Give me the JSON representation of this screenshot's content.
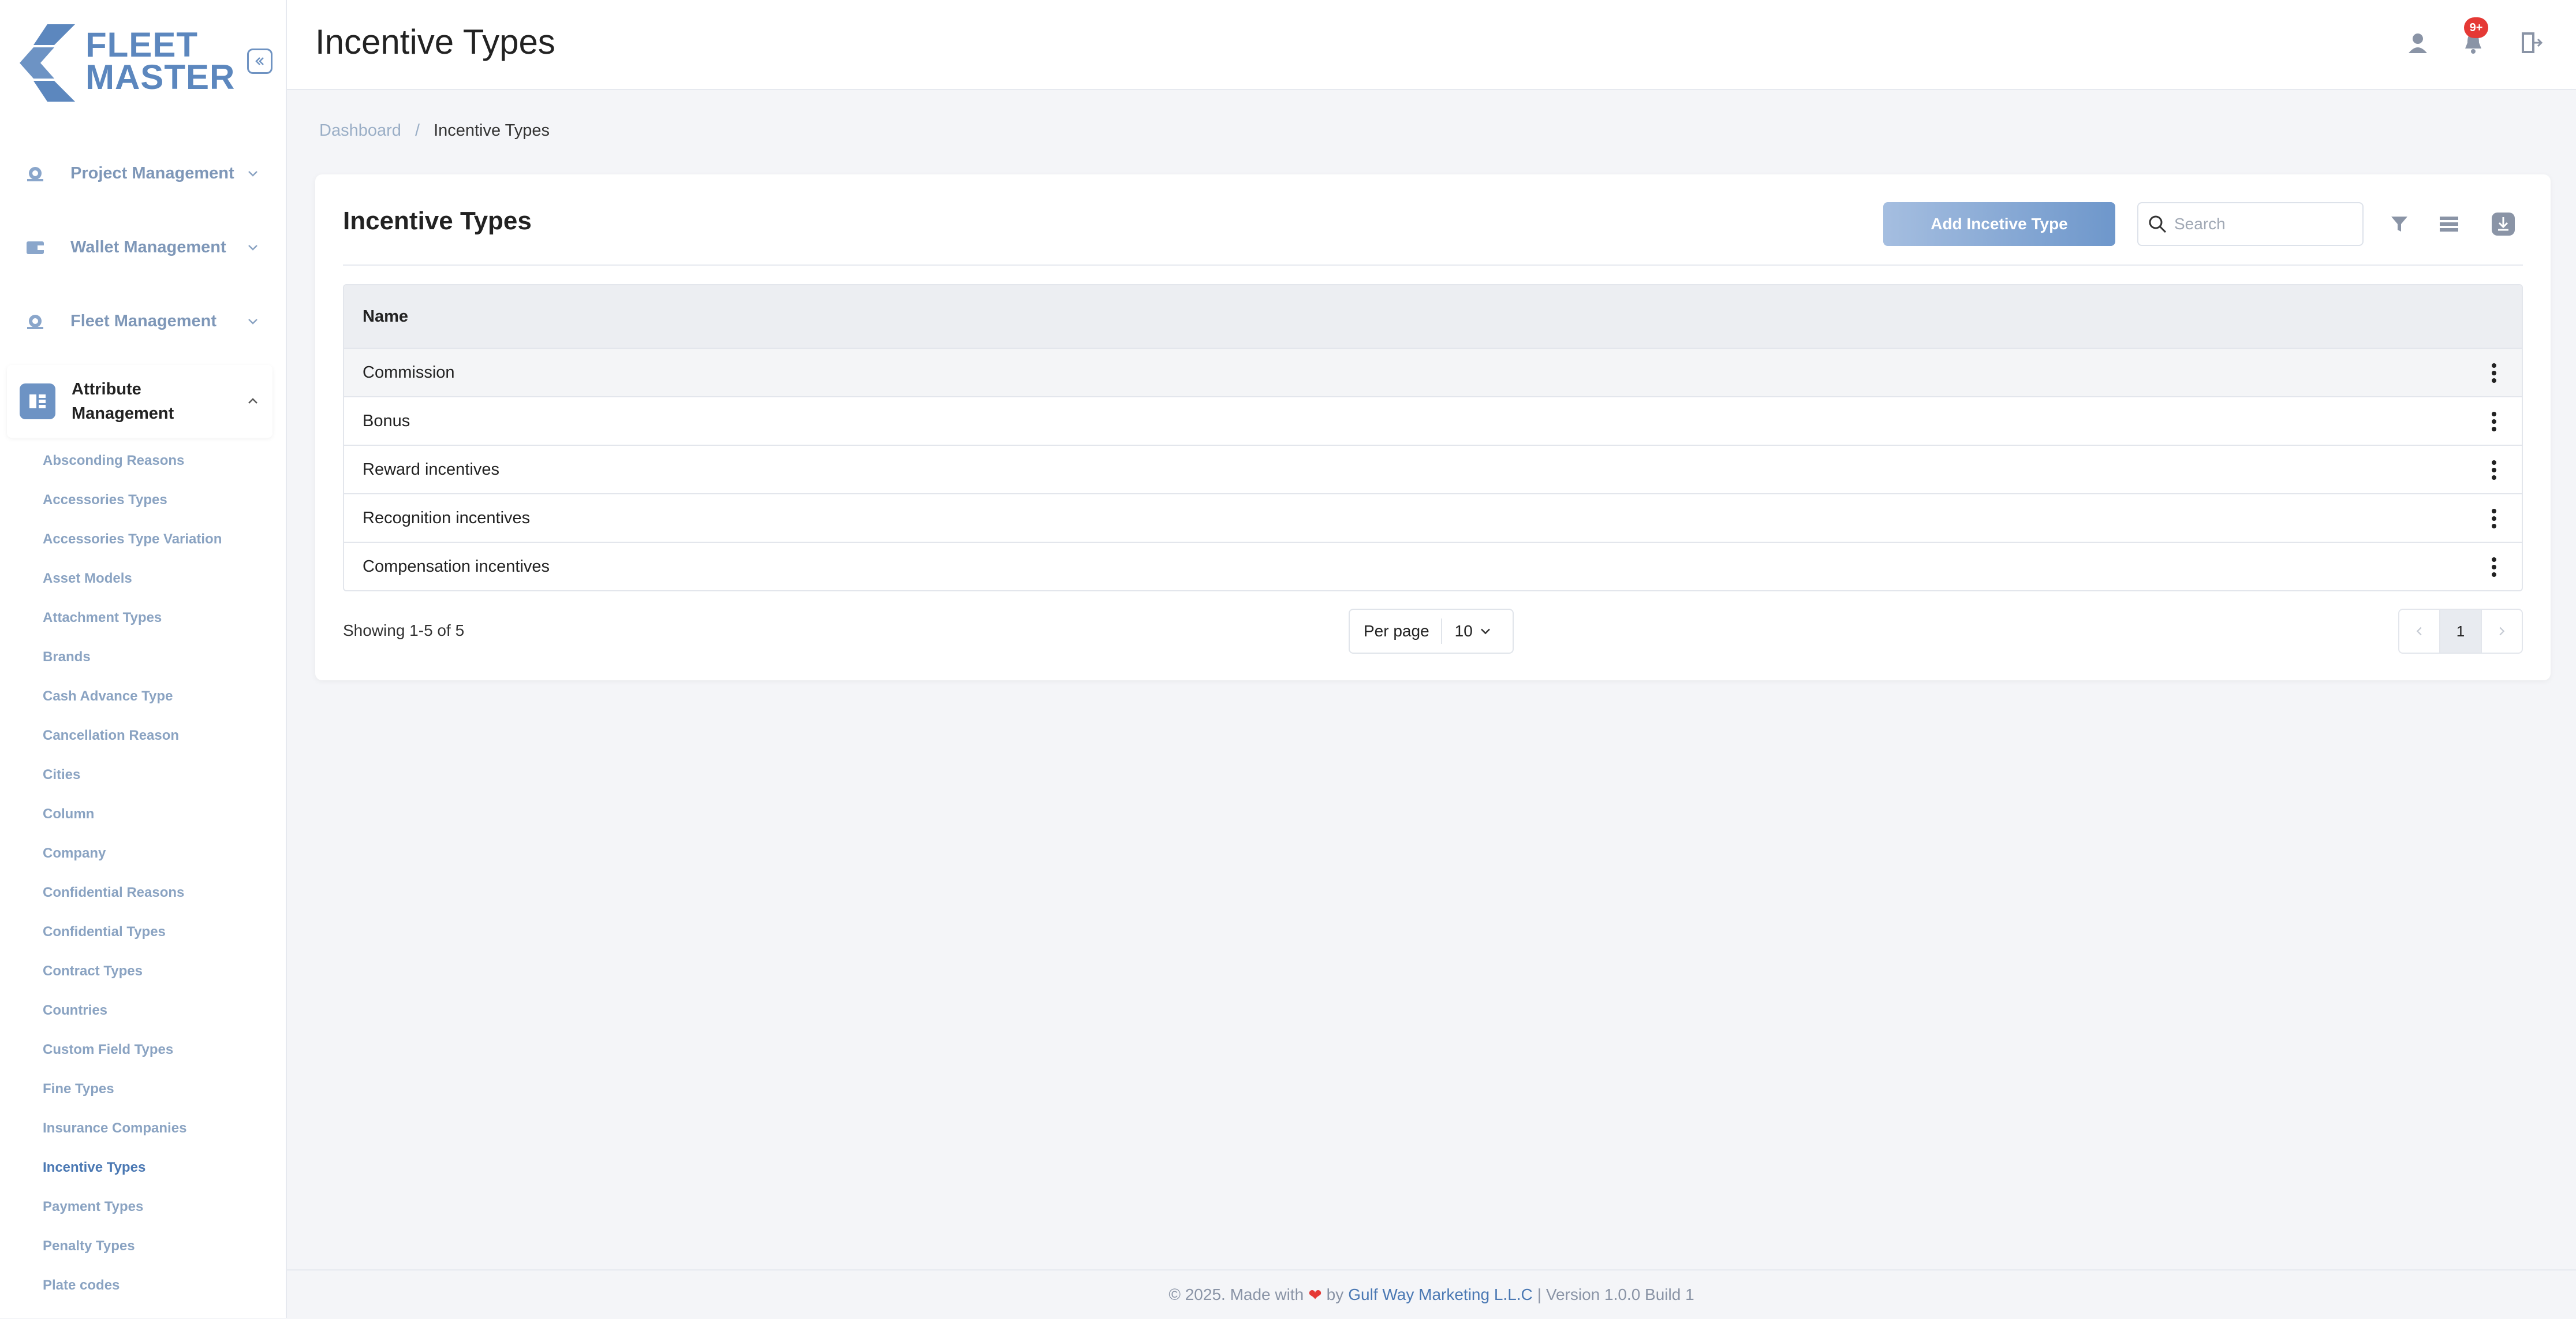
{
  "brand": {
    "line1": "FLEET",
    "line2": "MASTER",
    "color": "#5c87be"
  },
  "header": {
    "title": "Incentive Types",
    "notification_badge": "9+"
  },
  "sidebar": {
    "groups": [
      {
        "label": "Project Management",
        "icon": "project-icon"
      },
      {
        "label": "Wallet Management",
        "icon": "wallet-icon"
      },
      {
        "label": "Fleet Management",
        "icon": "fleet-icon"
      }
    ],
    "active_group": {
      "line1": "Attribute",
      "line2": "Management",
      "icon": "attribute-icon"
    },
    "sub_items": [
      "Absconding Reasons",
      "Accessories Types",
      "Accessories Type Variation",
      "Asset Models",
      "Attachment Types",
      "Brands",
      "Cash Advance Type",
      "Cancellation Reason",
      "Cities",
      "Column",
      "Company",
      "Confidential Reasons",
      "Confidential Types",
      "Contract Types",
      "Countries",
      "Custom Field Types",
      "Fine Types",
      "Insurance Companies",
      "Incentive Types",
      "Payment Types",
      "Penalty Types",
      "Plate codes"
    ],
    "current_item": "Incentive Types"
  },
  "breadcrumb": {
    "root": "Dashboard",
    "separator": "/",
    "current": "Incentive Types"
  },
  "card": {
    "title": "Incentive Types",
    "add_button": "Add Incetive Type",
    "search_placeholder": "Search"
  },
  "table": {
    "column_header": "Name",
    "rows": [
      "Commission",
      "Bonus",
      "Reward incentives",
      "Recognition incentives",
      "Compensation incentives"
    ]
  },
  "pagination": {
    "showing": "Showing 1-5 of 5",
    "per_page_label": "Per page",
    "per_page_value": "10",
    "current_page": "1"
  },
  "footer": {
    "prefix": "© 2025. Made with",
    "heart": "❤",
    "by": "by",
    "company": "Gulf Way Marketing L.L.C",
    "suffix": "| Version 1.0.0 Build 1"
  },
  "colors": {
    "accent": "#6e97cb",
    "link": "#4a78b3",
    "badge": "#e53935"
  }
}
